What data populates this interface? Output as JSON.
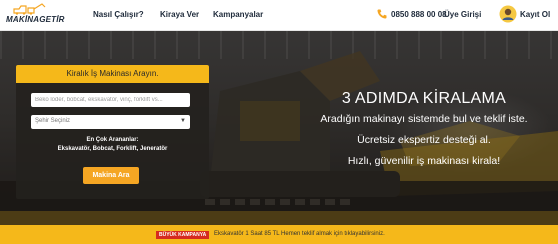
{
  "header": {
    "logo_text": "MAKİNAGETİR",
    "nav": [
      "Nasıl Çalışır?",
      "Kiraya Ver",
      "Kampanyalar"
    ],
    "phone": "0850 888 00 08",
    "login": "Üye Girişi",
    "signup": "Kayıt Ol"
  },
  "search": {
    "title": "Kiralık İş Makinası Arayın.",
    "input_placeholder": "Beko loder, bobcat, ekskavatör, vinç, forklift vs...",
    "select_value": "Şehir Seçiniz",
    "popular_title": "En Çok Arananlar:",
    "popular_items": "Ekskavatör, Bobcat, Forklift, Jeneratör",
    "button": "Makina Ara"
  },
  "hero": {
    "heading": "3 ADIMDA KİRALAMA",
    "lines": [
      "Aradığın makinayı sistemde bul ve teklif iste.",
      "Ücretsiz ekspertiz desteği al.",
      "Hızlı, güvenilir iş makinası kirala!"
    ]
  },
  "campaign": {
    "badge": "BÜYÜK KAMPANYA",
    "text": "Ekskavatör 1 Saat 85 TL Hemen teklif almak için tıklayabilirsiniz."
  },
  "colors": {
    "accent": "#f5b81a",
    "button": "#f5a623",
    "badge": "#d62b1f",
    "nav_text": "#1e2a3a"
  },
  "icons": [
    "logo-machines-icon",
    "phone-icon",
    "user-avatar-icon",
    "chevron-down-icon"
  ]
}
